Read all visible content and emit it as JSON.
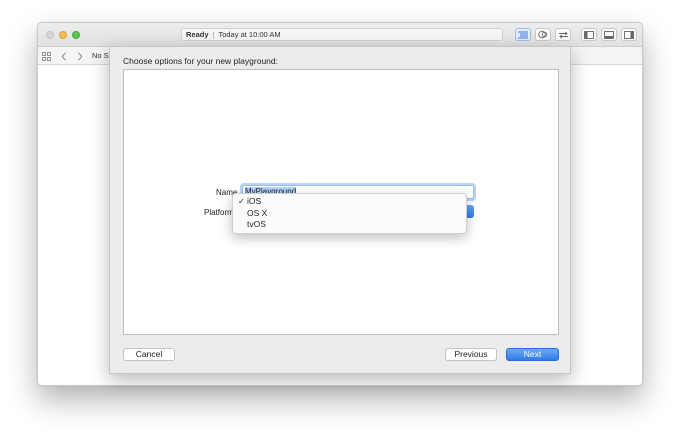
{
  "window": {
    "status_state": "Ready",
    "status_time": "Today at 10:00 AM",
    "jump_bar_text": "No Se"
  },
  "icons": {
    "related_items": "grid-icon",
    "back": "chevron-left-icon",
    "forward": "chevron-right-icon",
    "standard_editor": "lines-icon",
    "assistant_editor": "rings-icon",
    "version_editor": "arrows-icon",
    "navigator": "left-panel-icon",
    "debug_area": "bottom-panel-icon",
    "utilities": "right-panel-icon"
  },
  "sheet": {
    "title": "Choose options for your new playground:",
    "name_label": "Name",
    "name_value": "MyPlayground",
    "platform_label": "Platform",
    "platform_options": [
      "iOS",
      "OS X",
      "tvOS"
    ],
    "platform_selected": "iOS",
    "check_mark": "✓",
    "cancel_label": "Cancel",
    "previous_label": "Previous",
    "next_label": "Next"
  },
  "colors": {
    "accent": "#2e7be9",
    "selection": "#b3d4fd",
    "traffic_min": "#f5bd4f",
    "traffic_max": "#61c454"
  }
}
